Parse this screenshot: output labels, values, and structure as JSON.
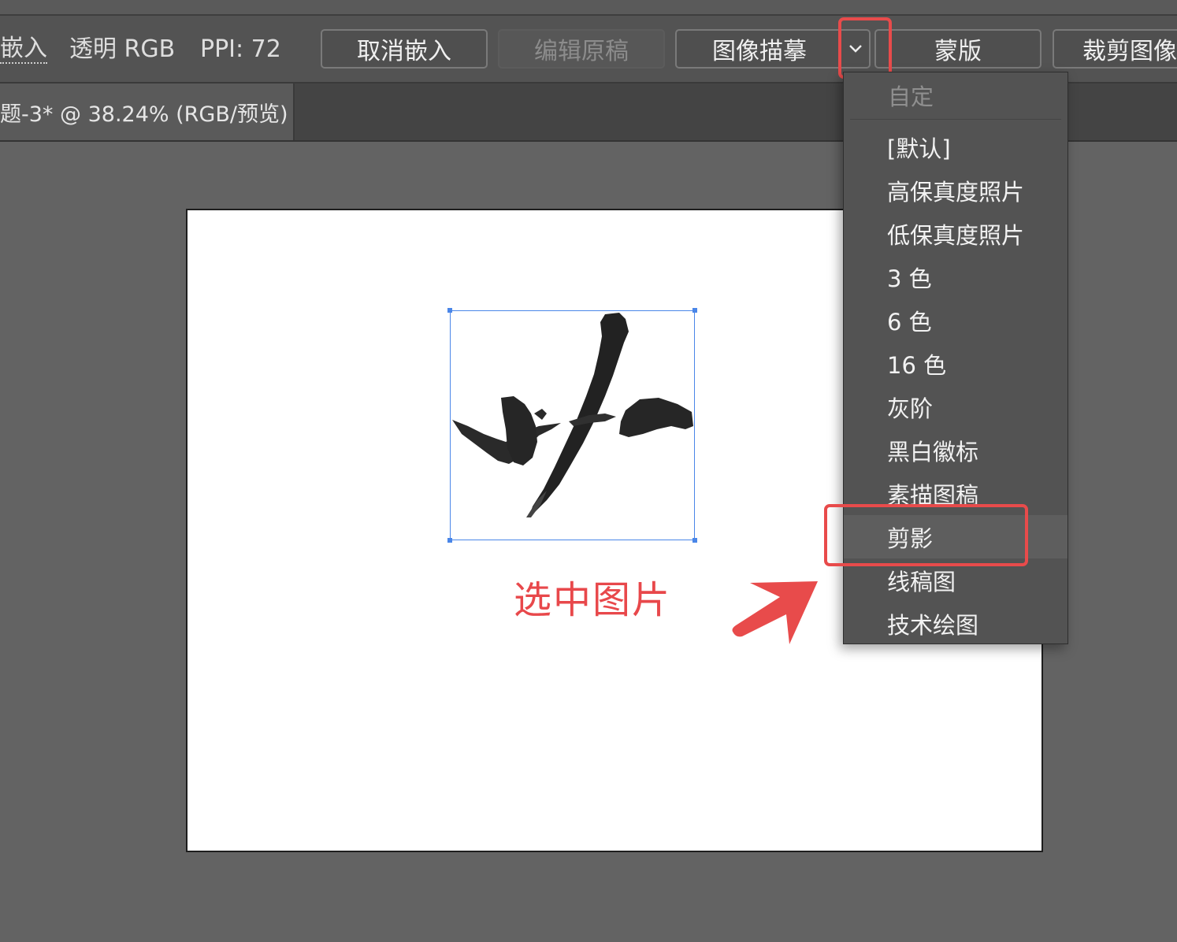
{
  "control_bar": {
    "embedded_label": "嵌入",
    "color_info": "透明 RGB",
    "ppi": "PPI: 72",
    "unembed_button": "取消嵌入",
    "edit_original_button": "编辑原稿",
    "image_trace_button": "图像描摹",
    "mask_button": "蒙版",
    "crop_button": "裁剪图像"
  },
  "document_tab": {
    "title": "题-3* @ 38.24% (RGB/预览)"
  },
  "dropdown": {
    "header": "自定",
    "items": [
      {
        "label": "[默认]"
      },
      {
        "label": "高保真度照片"
      },
      {
        "label": "低保真度照片"
      },
      {
        "label": "3 色"
      },
      {
        "label": "6 色"
      },
      {
        "label": "16 色"
      },
      {
        "label": "灰阶"
      },
      {
        "label": "黑白徽标"
      },
      {
        "label": "素描图稿"
      },
      {
        "label": "剪影",
        "highlighted": true
      },
      {
        "label": "线稿图"
      },
      {
        "label": "技术绘图"
      }
    ]
  },
  "annotation": {
    "caption": "选中图片",
    "accent_color": "#e84b4b"
  },
  "selection_color": "#4a86e8"
}
